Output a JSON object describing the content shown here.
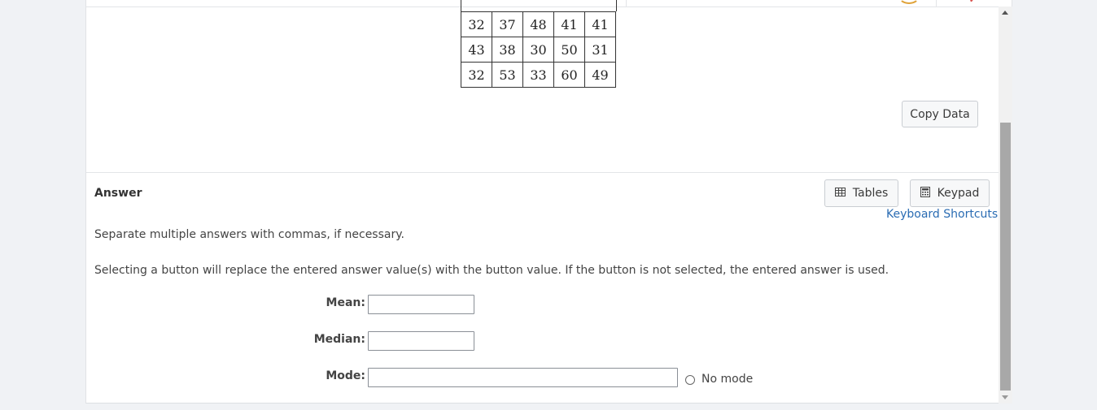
{
  "data_table": {
    "rows": [
      [
        "32",
        "37",
        "48",
        "41",
        "41"
      ],
      [
        "43",
        "38",
        "30",
        "50",
        "31"
      ],
      [
        "32",
        "53",
        "33",
        "60",
        "49"
      ]
    ]
  },
  "buttons": {
    "copy_data": "Copy Data",
    "tables": "Tables",
    "keypad": "Keypad"
  },
  "answer": {
    "title": "Answer",
    "keyboard_shortcuts": "Keyboard Shortcuts",
    "instruction_1": "Separate multiple answers with commas, if necessary.",
    "instruction_2": "Selecting a button will replace the entered answer value(s) with the button value. If the button is not selected, the entered answer is used.",
    "mean_label": "Mean:",
    "median_label": "Median:",
    "mode_label": "Mode:",
    "mean_value": "",
    "median_value": "",
    "mode_value": "",
    "no_mode_label": "No mode"
  },
  "icons": {
    "tables": "table-grid-icon",
    "keypad": "calculator-icon"
  }
}
